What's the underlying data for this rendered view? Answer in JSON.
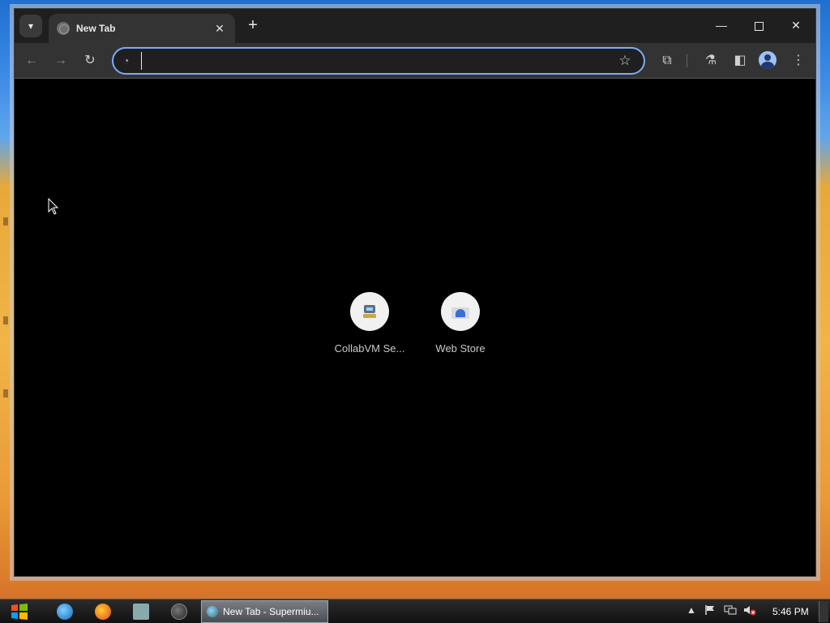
{
  "window": {
    "tab_title": "New Tab",
    "tab_close": "✕",
    "new_tab": "+",
    "minimize": "—",
    "close": "✕"
  },
  "toolbar": {
    "back": "←",
    "forward": "→",
    "reload": "↻",
    "address_value": "",
    "star": "☆",
    "extensions": "⧉",
    "labs": "⚗",
    "side_panel": "◧",
    "menu": "⋮"
  },
  "shortcuts": [
    {
      "label": "CollabVM Se...",
      "icon": "collabvm-icon"
    },
    {
      "label": "Web Store",
      "icon": "web-store-icon"
    }
  ],
  "taskbar": {
    "active_window": "New Tab - Supermiu...",
    "tray_up": "▲",
    "clock": "5:46 PM"
  },
  "colors": {
    "focus_ring": "#7cacf8",
    "tab_bg": "#333333",
    "content_bg": "#000000"
  }
}
